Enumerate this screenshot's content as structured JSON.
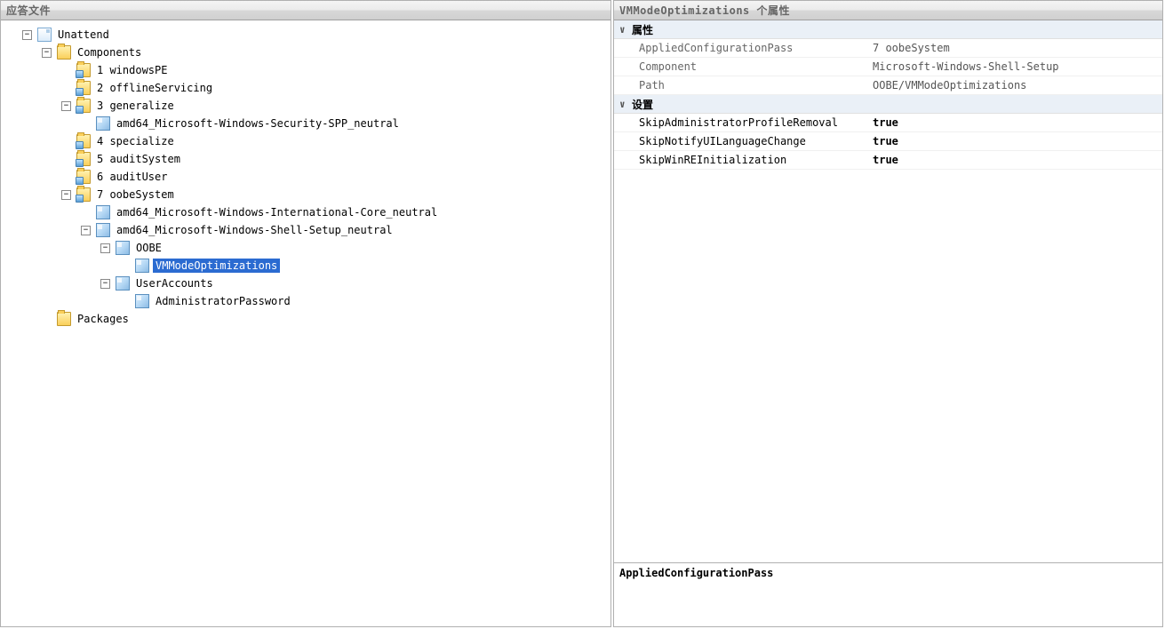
{
  "left": {
    "title": "应答文件",
    "root": "Unattend",
    "components": "Components",
    "packages": "Packages",
    "passes": {
      "p1": "1 windowsPE",
      "p2": "2 offlineServicing",
      "p3": "3 generalize",
      "p3_child": "amd64_Microsoft-Windows-Security-SPP_neutral",
      "p4": "4 specialize",
      "p5": "5 auditSystem",
      "p6": "6 auditUser",
      "p7": "7 oobeSystem",
      "p7_c1": "amd64_Microsoft-Windows-International-Core_neutral",
      "p7_c2": "amd64_Microsoft-Windows-Shell-Setup_neutral",
      "oobe": "OOBE",
      "vmmode": "VMModeOptimizations",
      "useraccounts": "UserAccounts",
      "adminpwd": "AdministratorPassword"
    }
  },
  "right": {
    "title": "VMModeOptimizations 个属性",
    "group_attr": "属性",
    "group_set": "设置",
    "attrs": {
      "acp_label": "AppliedConfigurationPass",
      "acp_value": "7 oobeSystem",
      "comp_label": "Component",
      "comp_value": "Microsoft-Windows-Shell-Setup",
      "path_label": "Path",
      "path_value": "OOBE/VMModeOptimizations"
    },
    "settings": {
      "s1_label": "SkipAdministratorProfileRemoval",
      "s1_value": "true",
      "s2_label": "SkipNotifyUILanguageChange",
      "s2_value": "true",
      "s3_label": "SkipWinREInitialization",
      "s3_value": "true"
    },
    "desc": "AppliedConfigurationPass"
  },
  "glyph": {
    "minus": "−",
    "plus": "+",
    "chev": "∨"
  }
}
